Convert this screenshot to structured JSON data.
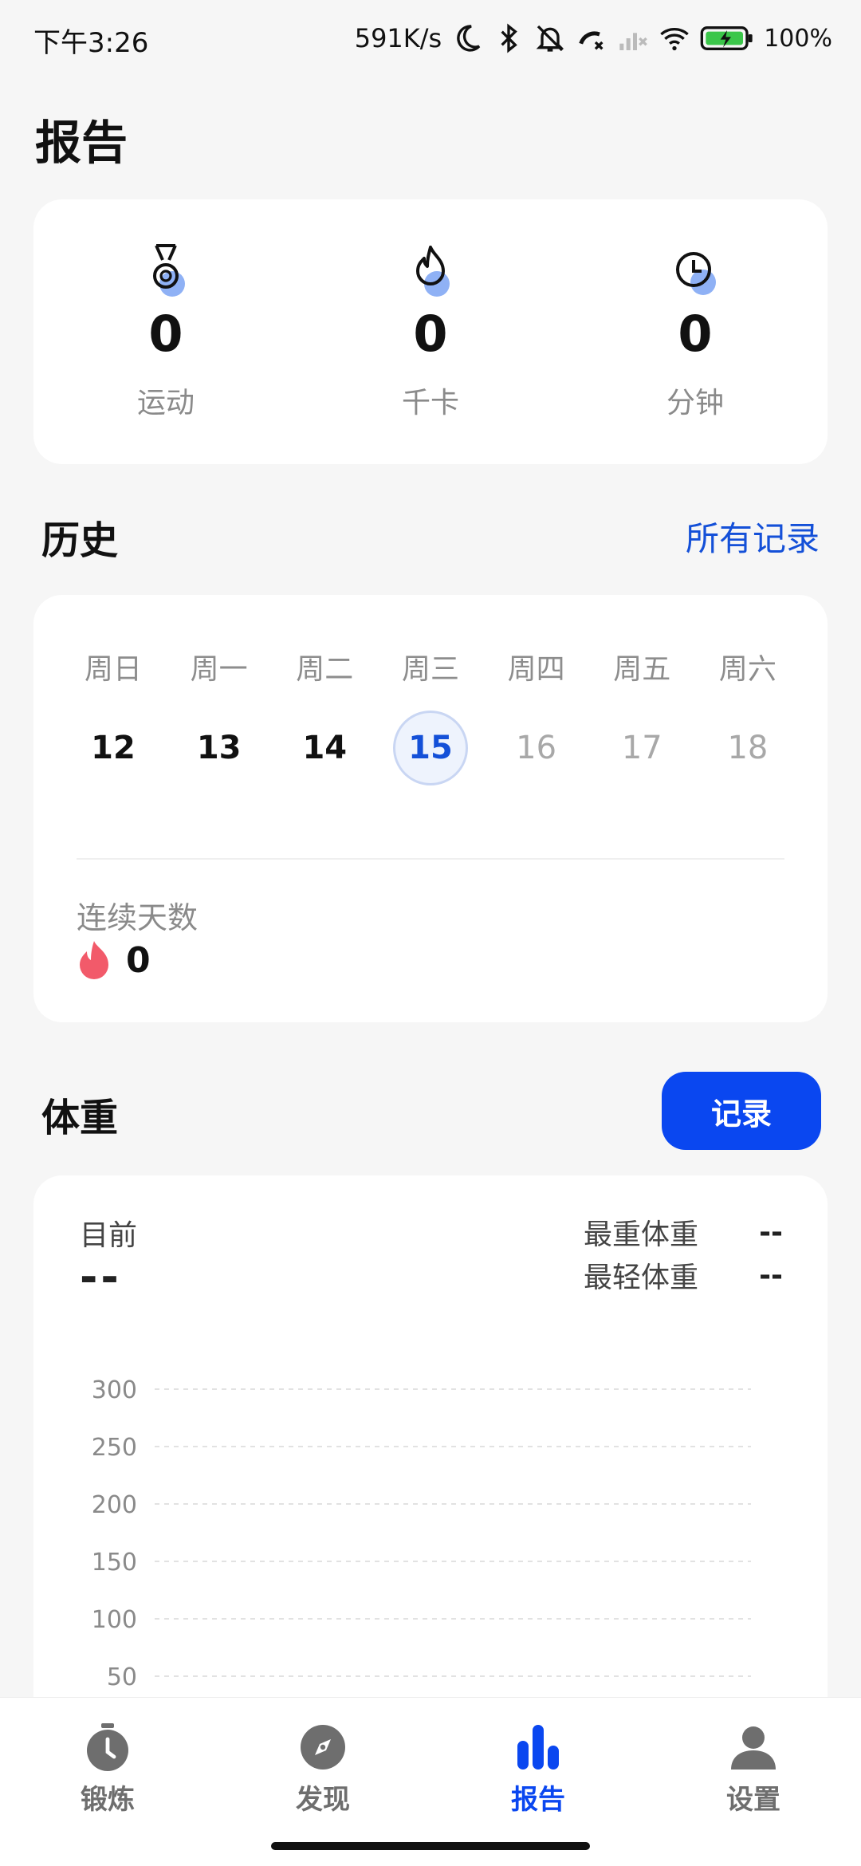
{
  "status_bar": {
    "time": "下午3:26",
    "network_speed": "591K/s",
    "battery": "100%"
  },
  "page": {
    "title": "报告"
  },
  "summary": {
    "stats": [
      {
        "icon": "medal-icon",
        "value": "0",
        "label": "运动"
      },
      {
        "icon": "flame-icon",
        "value": "0",
        "label": "千卡"
      },
      {
        "icon": "clock-icon",
        "value": "0",
        "label": "分钟"
      }
    ]
  },
  "history": {
    "title": "历史",
    "all_records": "所有记录",
    "weekdays": [
      "周日",
      "周一",
      "周二",
      "周三",
      "周四",
      "周五",
      "周六"
    ],
    "days": [
      "12",
      "13",
      "14",
      "15",
      "16",
      "17",
      "18"
    ],
    "today_index": 3,
    "streak_label": "连续天数",
    "streak_value": "0"
  },
  "weight": {
    "title": "体重",
    "record_button": "记录",
    "current_label": "目前",
    "current_value": "--",
    "max_label": "最重体重",
    "max_value": "--",
    "min_label": "最轻体重",
    "min_value": "--"
  },
  "chart_data": {
    "type": "line",
    "y_ticks": [
      300,
      250,
      200,
      150,
      100,
      50
    ],
    "grid": true,
    "series": []
  },
  "nav": {
    "items": [
      {
        "icon": "stopwatch-icon",
        "label": "锻炼",
        "active": false
      },
      {
        "icon": "compass-icon",
        "label": "发现",
        "active": false
      },
      {
        "icon": "bar-chart-icon",
        "label": "报告",
        "active": true
      },
      {
        "icon": "person-icon",
        "label": "设置",
        "active": false
      }
    ]
  },
  "colors": {
    "accent": "#0a47f0",
    "link": "#1450d8",
    "icon_accent": "#8fb1f5",
    "streak_flame": "#f25a6a"
  }
}
